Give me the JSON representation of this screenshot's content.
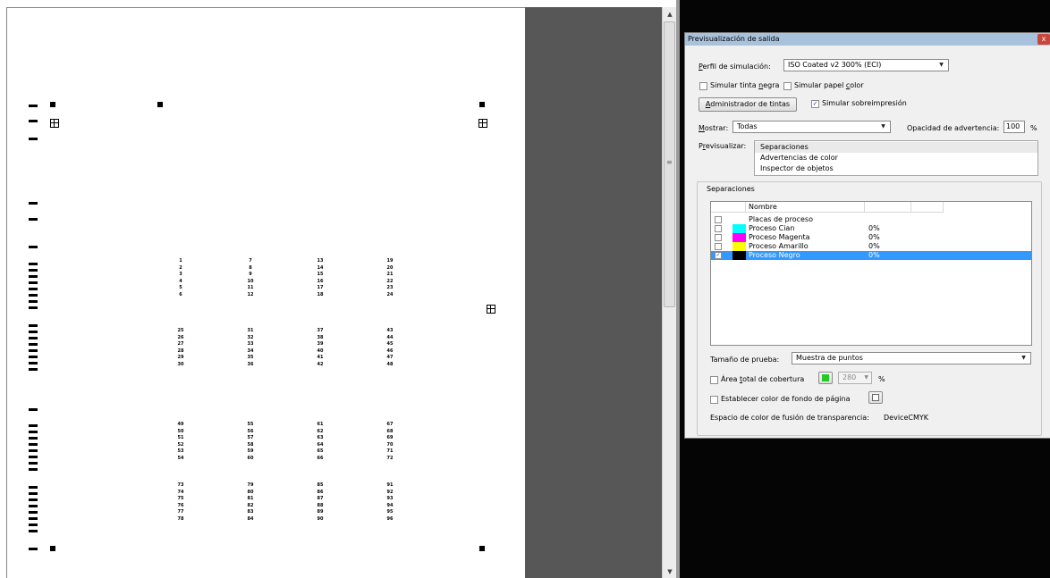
{
  "document": {
    "grid_numbers": [
      [
        "1",
        "2",
        "3",
        "4",
        "5",
        "6"
      ],
      [
        "7",
        "8",
        "9",
        "10",
        "11",
        "12"
      ],
      [
        "13",
        "14",
        "15",
        "16",
        "17",
        "18"
      ],
      [
        "19",
        "20",
        "21",
        "22",
        "23",
        "24"
      ],
      [
        "25",
        "26",
        "27",
        "28",
        "29",
        "30"
      ],
      [
        "31",
        "32",
        "33",
        "34",
        "35",
        "36"
      ],
      [
        "37",
        "38",
        "39",
        "40",
        "41",
        "42"
      ],
      [
        "43",
        "44",
        "45",
        "46",
        "47",
        "48"
      ],
      [
        "49",
        "50",
        "51",
        "52",
        "53",
        "54"
      ],
      [
        "55",
        "56",
        "57",
        "58",
        "59",
        "60"
      ],
      [
        "61",
        "62",
        "63",
        "64",
        "65",
        "66"
      ],
      [
        "67",
        "68",
        "69",
        "70",
        "71",
        "72"
      ],
      [
        "73",
        "74",
        "75",
        "76",
        "77",
        "78"
      ],
      [
        "79",
        "80",
        "81",
        "82",
        "83",
        "84"
      ],
      [
        "85",
        "86",
        "87",
        "88",
        "89",
        "90"
      ],
      [
        "91",
        "92",
        "93",
        "94",
        "95",
        "96"
      ]
    ]
  },
  "dialog": {
    "title": "Previsualización de salida",
    "close_glyph": "x",
    "perfil_label": "Perfil de simulación:",
    "perfil_label_u": "P",
    "perfil_label_rest": "erfil de simulación:",
    "perfil_value": "ISO Coated v2 300% (ECI)",
    "simular_tinta_pre": "Simular tinta ",
    "simular_tinta_u": "n",
    "simular_tinta_post": "egra",
    "simular_papel_pre": "Simular papel ",
    "simular_papel_u": "c",
    "simular_papel_post": "olor",
    "admin_btn_u": "A",
    "admin_btn_rest": "dministrador de tintas",
    "simular_sobre": "Simular sobreimpresión",
    "simular_sobre_checked": true,
    "mostrar_u": "M",
    "mostrar_rest": "ostrar:",
    "mostrar_value": "Todas",
    "opacidad_label": "Opacidad de advertencia:",
    "opacidad_value": "100",
    "opacidad_unit": "%",
    "previsualizar_pre": "P",
    "previsualizar_u": "r",
    "previsualizar_post": "evisualizar:",
    "previsualizar_options": [
      "Separaciones",
      "Advertencias de color",
      "Inspector de objetos"
    ],
    "separaciones_title": "Separaciones",
    "list_header": "Nombre",
    "rows": [
      {
        "name": "Placas de proceso",
        "percent": "",
        "checked": false,
        "swatch": "",
        "selected": false
      },
      {
        "name": "Proceso Cian",
        "percent": "0%",
        "checked": false,
        "swatch": "#00ffff",
        "selected": false
      },
      {
        "name": "Proceso Magenta",
        "percent": "0%",
        "checked": false,
        "swatch": "#ff00ff",
        "selected": false
      },
      {
        "name": "Proceso Amarillo",
        "percent": "0%",
        "checked": false,
        "swatch": "#ffff00",
        "selected": false
      },
      {
        "name": "Proceso Negro",
        "percent": "0%",
        "checked": true,
        "swatch": "#000000",
        "selected": true
      }
    ],
    "tamano_label": "Tamaño de prueba:",
    "tamano_value": "Muestra de puntos",
    "area_pre": "Área ",
    "area_u": "t",
    "area_post": "otal de cobertura",
    "area_color": "#22cc22",
    "area_value": "280",
    "area_unit": "%",
    "fondo_label": "Establecer color de fondo de página",
    "fusion_label": "Espacio de color de fusión de transparencia:",
    "fusion_value": "DeviceCMYK"
  },
  "colors": {
    "selection": "#3399ff",
    "title_bar": "#a9c2dc",
    "gutter": "#575757",
    "dark_panel": "#050505"
  }
}
